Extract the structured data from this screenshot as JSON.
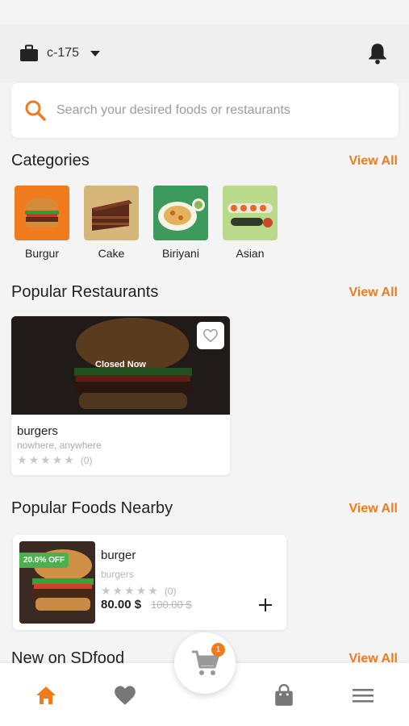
{
  "colors": {
    "accent": "#f07b1d",
    "offer_badge": "#4caf50",
    "background": "#f4f4f4"
  },
  "header": {
    "location_label": "c-175",
    "location_icon": "briefcase-icon",
    "notification_icon": "bell-icon"
  },
  "search": {
    "placeholder": "Search your desired foods or restaurants",
    "icon": "search-icon"
  },
  "categories": {
    "title": "Categories",
    "view_all": "View All",
    "items": [
      {
        "label": "Burgur"
      },
      {
        "label": "Cake"
      },
      {
        "label": "Biriyani"
      },
      {
        "label": "Asian"
      }
    ]
  },
  "popular_restaurants": {
    "title": "Popular Restaurants",
    "view_all": "View All",
    "items": [
      {
        "name": "burgers",
        "address": "nowhere, anywhere",
        "status": "Closed Now",
        "rating_count": "(0)",
        "rating_stars": 0
      }
    ]
  },
  "popular_foods": {
    "title": "Popular Foods Nearby",
    "view_all": "View All",
    "items": [
      {
        "name": "burger",
        "restaurant": "burgers",
        "discount": "20.0% OFF",
        "rating_count": "(0)",
        "rating_stars": 0,
        "price": "80.00 $",
        "old_price": "100.00 $",
        "add_icon": "plus-icon"
      }
    ]
  },
  "new_section": {
    "title": "New on SDfood",
    "view_all": "View All"
  },
  "bottom_nav": {
    "items": [
      "home-icon",
      "heart-icon",
      "cart-icon",
      "shopping-bag-icon",
      "menu-icon"
    ],
    "cart_badge": "1"
  }
}
